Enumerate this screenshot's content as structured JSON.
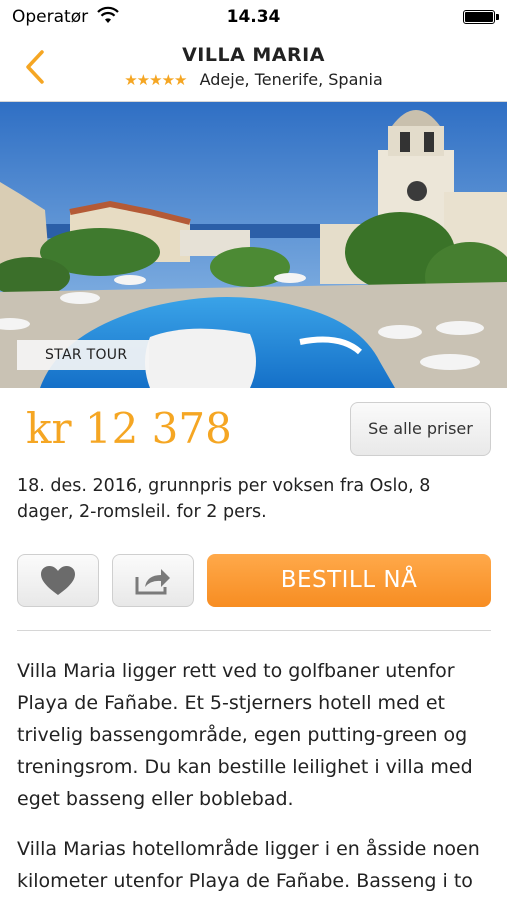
{
  "status": {
    "carrier": "Operatør",
    "time": "14.34"
  },
  "nav": {
    "title": "VILLA MARIA",
    "stars": "★★★★★",
    "location": "Adeje, Tenerife, Spania"
  },
  "hero": {
    "tag": "STAR TOUR"
  },
  "price": {
    "amount": "kr 12 378",
    "see_all": "Se alle priser"
  },
  "description": "18. des. 2016, grunnpris per voksen fra Oslo, 8 dager, 2-romsleil. for 2 pers.",
  "actions": {
    "book": "BESTILL NÅ"
  },
  "body": {
    "p1": "Villa Maria ligger rett ved to golfbaner utenfor Playa de Fañabe. Et 5-stjerners hotell med et trivelig bassengområde, egen putting-green og treningsrom. Du kan bestille leilighet i villa med eget basseng eller boblebad.",
    "p2": "Villa Marias hotellområde ligger i en åsside noen kilometer utenfor Playa de Fañabe. Basseng i to"
  },
  "colors": {
    "accent": "#f5a623",
    "book_button": "#f7931e"
  }
}
